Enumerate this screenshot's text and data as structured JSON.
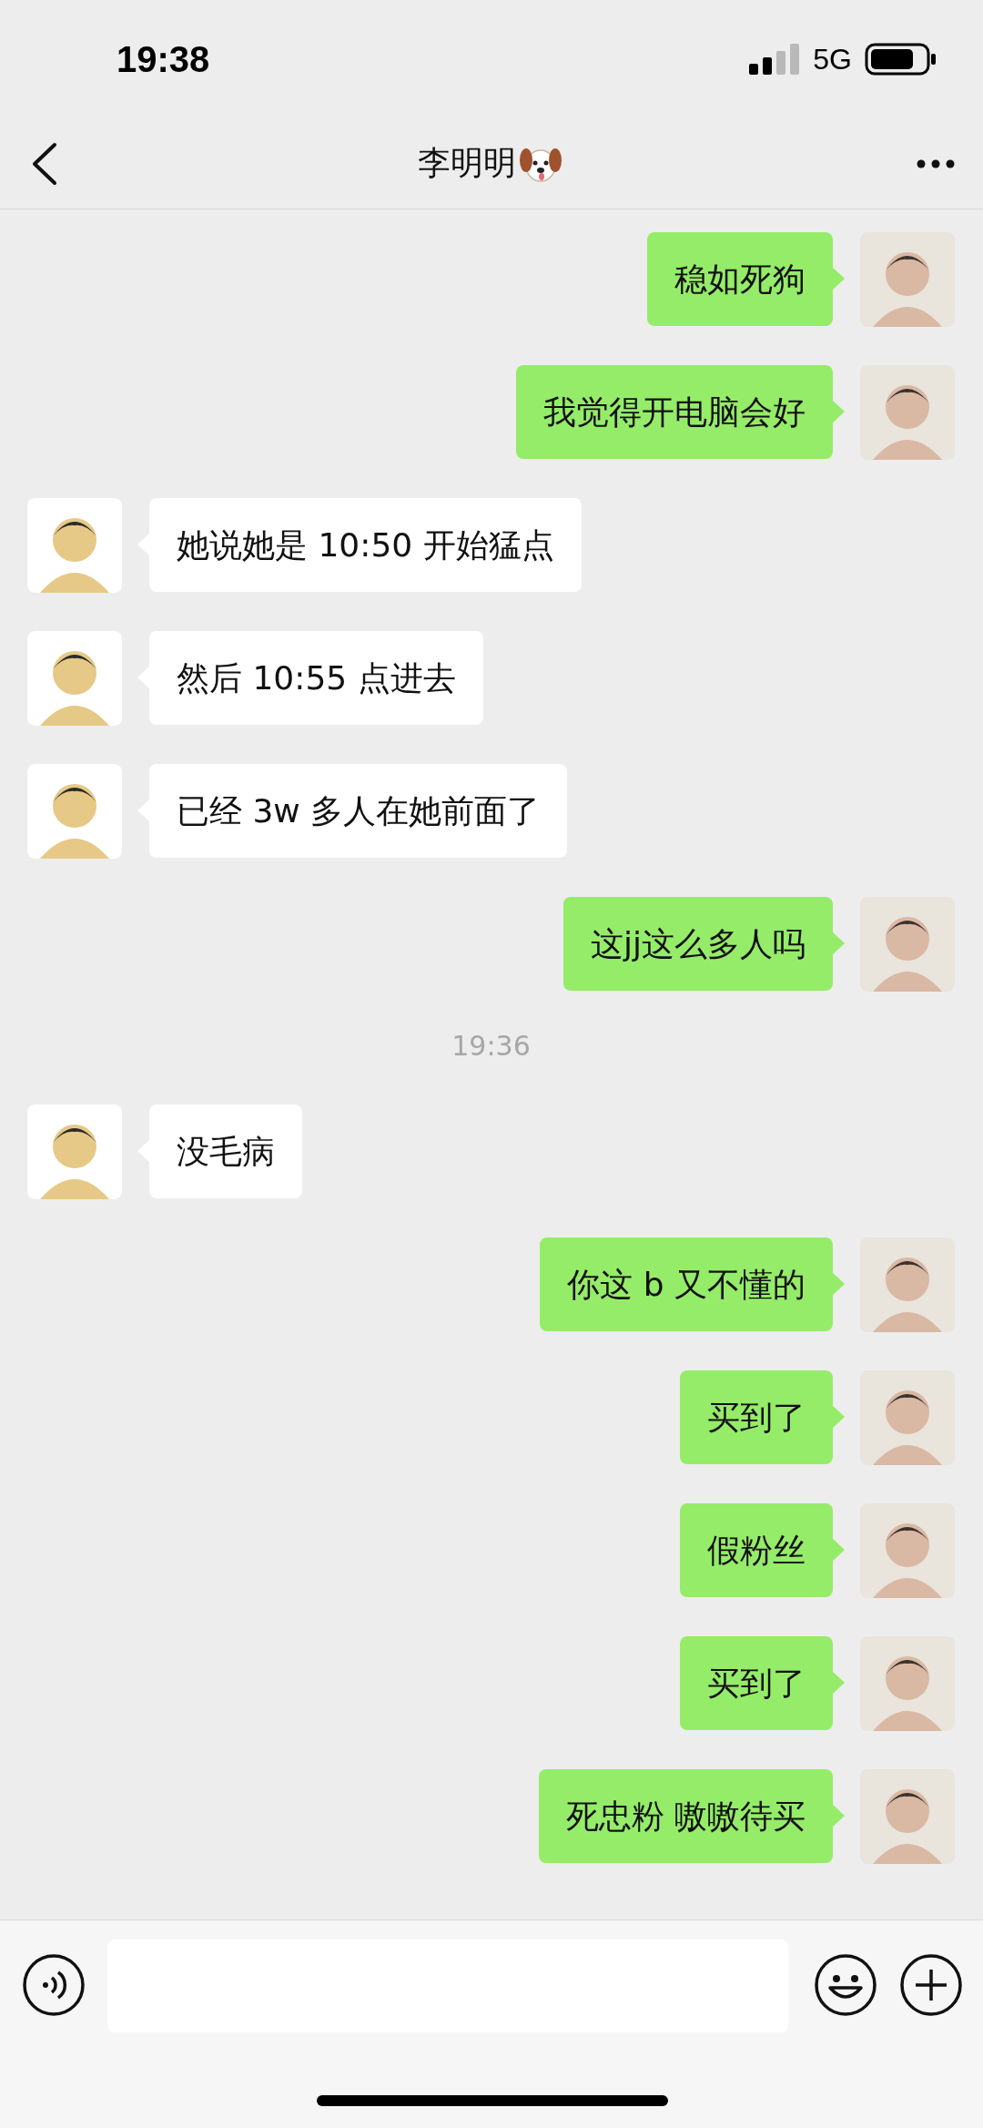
{
  "status_bar": {
    "time": "19:38",
    "network": "5G"
  },
  "nav": {
    "title": "李明明"
  },
  "messages": [
    {
      "kind": "outgoing",
      "text": "稳如死狗"
    },
    {
      "kind": "outgoing",
      "text": "我觉得开电脑会好"
    },
    {
      "kind": "incoming",
      "text": "她说她是 10:50 开始猛点"
    },
    {
      "kind": "incoming",
      "text": "然后 10:55 点进去"
    },
    {
      "kind": "incoming",
      "text": "已经 3w 多人在她前面了"
    },
    {
      "kind": "outgoing",
      "text": "这jj这么多人吗"
    },
    {
      "kind": "timestamp",
      "text": "19:36"
    },
    {
      "kind": "incoming",
      "text": "没毛病"
    },
    {
      "kind": "outgoing",
      "text": "你这 b 又不懂的"
    },
    {
      "kind": "outgoing",
      "text": "买到了"
    },
    {
      "kind": "outgoing",
      "text": "假粉丝"
    },
    {
      "kind": "outgoing",
      "text": "买到了"
    },
    {
      "kind": "outgoing",
      "text": "死忠粉 嗷嗷待买"
    }
  ]
}
